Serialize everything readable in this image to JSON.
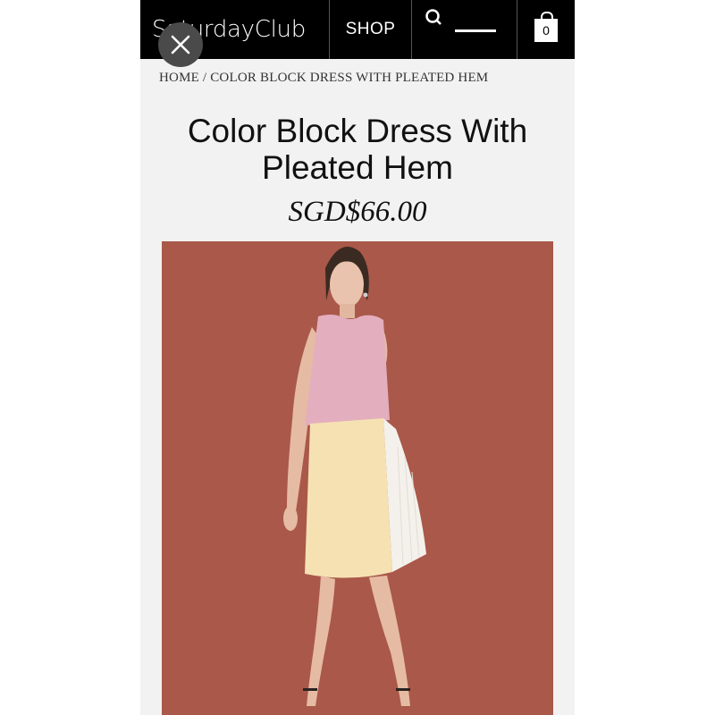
{
  "header": {
    "logo": "SaturdayClub",
    "shop_label": "SHOP",
    "cart_count": "0"
  },
  "breadcrumb": "HOME / COLOR BLOCK DRESS WITH PLEATED HEM",
  "product": {
    "title": "Color Block Dress With Pleated Hem",
    "price": "SGD$66.00",
    "image": "model-wearing-dress"
  },
  "colors": {
    "header_bg": "#000000",
    "page_bg": "#f2f2f2",
    "photo_bg": "#a9584a",
    "dress_top": "#e3aebd",
    "dress_skirt": "#f6e1b3",
    "dress_pleat": "#f4f1ec"
  }
}
